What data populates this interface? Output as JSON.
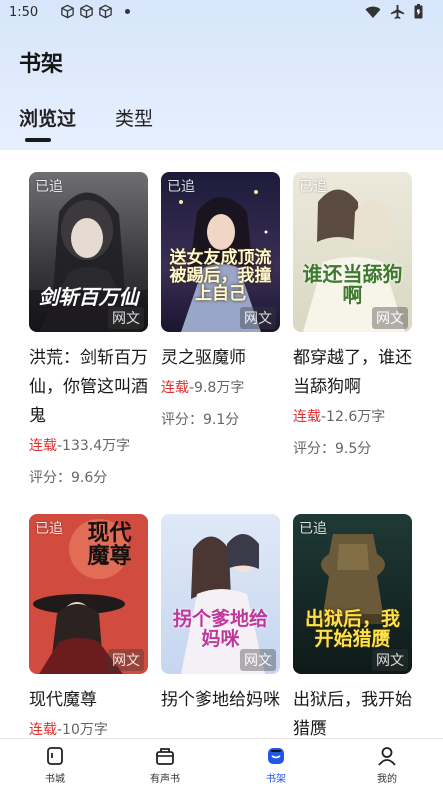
{
  "status_bar": {
    "time": "1:50"
  },
  "page_title": "书架",
  "tabs": [
    {
      "label": "浏览过",
      "active": true
    },
    {
      "label": "类型",
      "active": false
    }
  ],
  "books": [
    {
      "title": "洪荒：剑斩百万仙，你管这叫酒鬼",
      "cover_text": "剑斩百万仙",
      "badge_followed": "已追",
      "badge_web": "网文",
      "serial_label": "连载",
      "word_count": "-133.4万字",
      "rating": "评分：9.6分"
    },
    {
      "title": "灵之驱魔师",
      "cover_text": "送女友成顶流被踢后，我撞上自己",
      "badge_followed": "已追",
      "badge_web": "网文",
      "serial_label": "连载",
      "word_count": "-9.8万字",
      "rating": "评分：9.1分"
    },
    {
      "title": "都穿越了，谁还当舔狗啊",
      "cover_text": "谁还当舔狗啊",
      "badge_followed": "已追",
      "badge_web": "网文",
      "serial_label": "连载",
      "word_count": "-12.6万字",
      "rating": "评分：9.5分"
    },
    {
      "title": "现代魔尊",
      "cover_text": "现代魔尊",
      "badge_followed": "已追",
      "badge_web": "网文",
      "serial_label": "连载",
      "word_count": "-10万字",
      "rating": ""
    },
    {
      "title": "拐个爹地给妈咪",
      "cover_text": "拐个爹地给妈咪",
      "badge_followed": "",
      "badge_web": "网文",
      "serial_label": "",
      "word_count": "",
      "rating": ""
    },
    {
      "title": "出狱后，我开始猎赝",
      "cover_text": "出狱后，我开始猎赝",
      "badge_followed": "已追",
      "badge_web": "网文",
      "serial_label": "",
      "word_count": "",
      "rating": ""
    }
  ],
  "bottom_nav": [
    {
      "label": "书城",
      "icon": "bookstore-icon",
      "active": false
    },
    {
      "label": "有声书",
      "icon": "audiobook-icon",
      "active": false
    },
    {
      "label": "书架",
      "icon": "bookshelf-icon",
      "active": true
    },
    {
      "label": "我的",
      "icon": "profile-icon",
      "active": false
    }
  ],
  "colors": {
    "accent": "#2156e6",
    "serial": "#e03030",
    "header_bg": "#dce8fb"
  }
}
